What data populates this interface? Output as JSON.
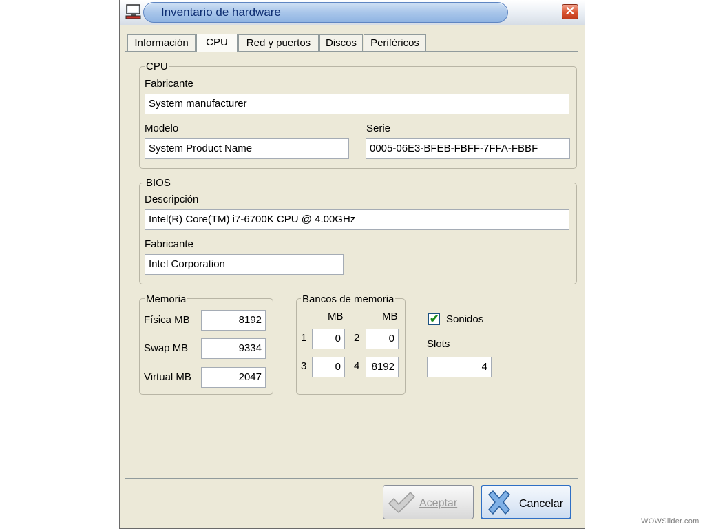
{
  "window": {
    "title": "Inventario de hardware",
    "close_symbol": "✕"
  },
  "tabs": [
    {
      "label": "Información",
      "active": false
    },
    {
      "label": "CPU",
      "active": true
    },
    {
      "label": "Red y puertos",
      "active": false
    },
    {
      "label": "Discos",
      "active": false
    },
    {
      "label": "Periféricos",
      "active": false
    }
  ],
  "cpu": {
    "legend": "CPU",
    "manufacturer_label": "Fabricante",
    "manufacturer_value": "System manufacturer",
    "model_label": "Modelo",
    "model_value": "System Product Name",
    "serial_label": "Serie",
    "serial_value": "0005-06E3-BFEB-FBFF-7FFA-FBBF"
  },
  "bios": {
    "legend": "BIOS",
    "description_label": "Descripción",
    "description_value": "Intel(R) Core(TM) i7-6700K CPU @ 4.00GHz",
    "manufacturer_label": "Fabricante",
    "manufacturer_value": "Intel Corporation"
  },
  "memory": {
    "legend": "Memoria",
    "physical_label": "Física MB",
    "physical_value": "8192",
    "swap_label": "Swap MB",
    "swap_value": "9334",
    "virtual_label": "Virtual MB",
    "virtual_value": "2047"
  },
  "banks": {
    "legend": "Bancos de memoria",
    "col1_header": "MB",
    "col2_header": "MB",
    "bank1_label": "1",
    "bank1_value": "0",
    "bank2_label": "2",
    "bank2_value": "0",
    "bank3_label": "3",
    "bank3_value": "0",
    "bank4_label": "4",
    "bank4_value": "8192"
  },
  "sounds": {
    "label": "Sonidos",
    "checked": true,
    "check_symbol": "✔"
  },
  "slots": {
    "label": "Slots",
    "value": "4"
  },
  "buttons": {
    "accept": "Aceptar",
    "cancel": "Cancelar"
  },
  "watermark": "WOWSlider.com",
  "colors": {
    "title_text": "#0f2f73",
    "window_bg": "#ece9d8",
    "check_green": "#1a8a1a",
    "cancel_blue": "#2f6fc5"
  }
}
